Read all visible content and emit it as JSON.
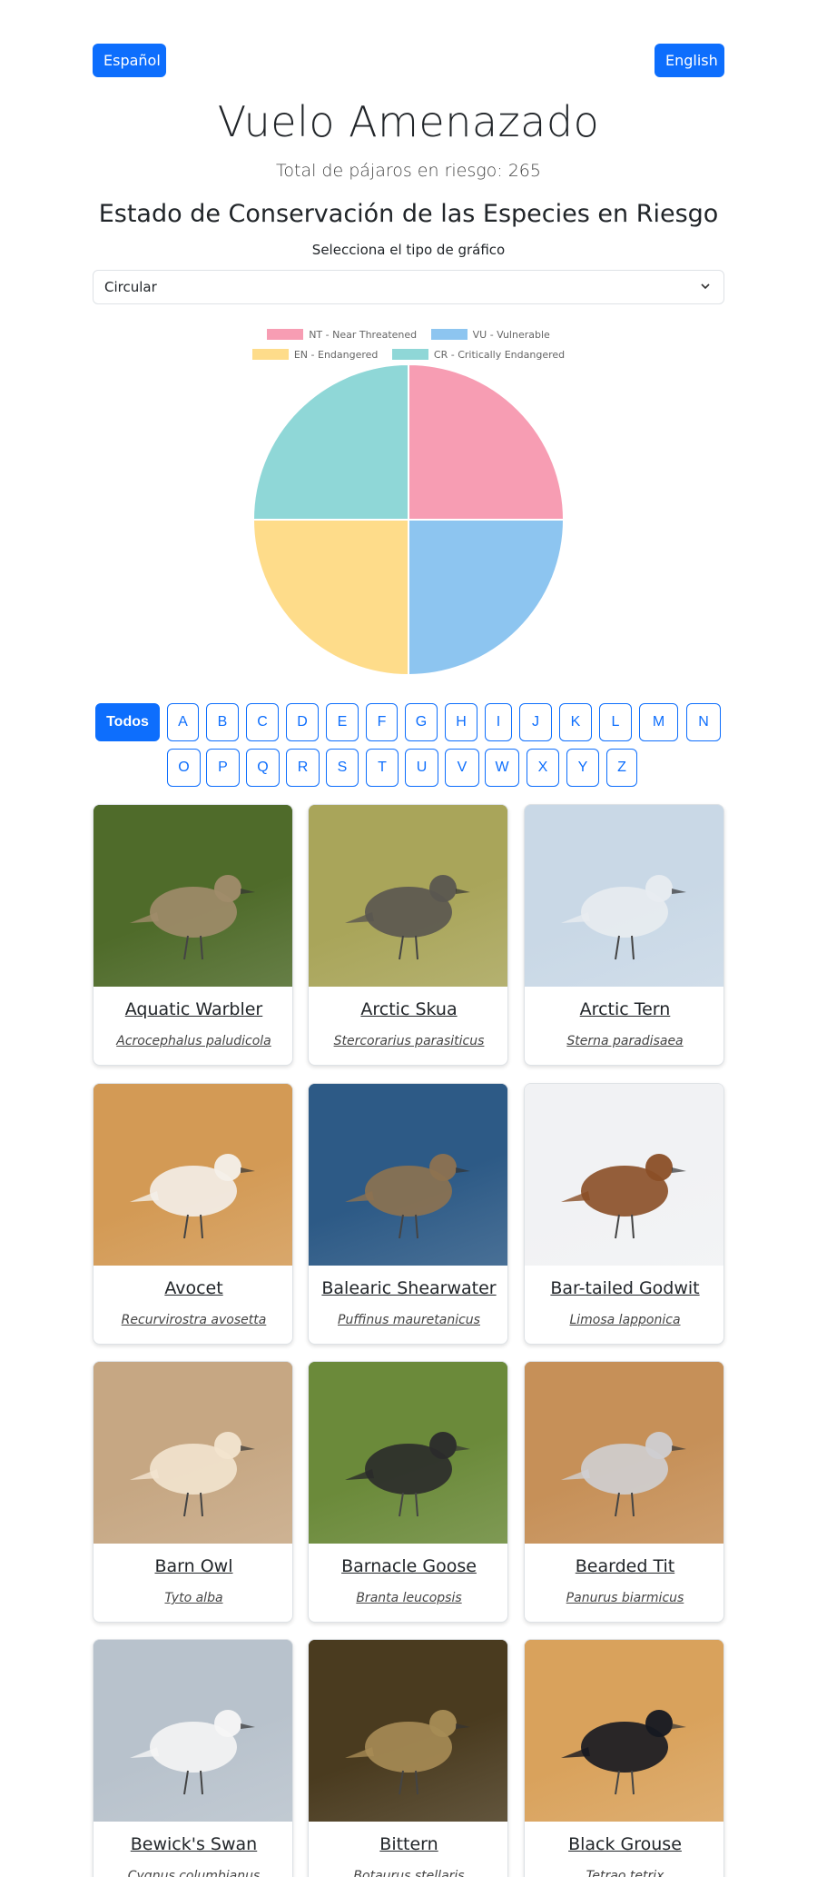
{
  "header": {
    "lang_es": "Español",
    "lang_en": "English",
    "title": "Vuelo Amenazado",
    "total": "Total de pájaros en riesgo: 265"
  },
  "chart_section": {
    "title": "Estado de Conservación de las Especies en Riesgo",
    "select_label": "Selecciona el tipo de gráfico",
    "select_value": "Circular"
  },
  "chart_data": {
    "type": "pie",
    "categories": [
      "NT - Near Threatened",
      "VU - Vulnerable",
      "EN - Endangered",
      "CR - Critically Endangered"
    ],
    "values": [
      25,
      25,
      25,
      25
    ],
    "colors": [
      "#f79db3",
      "#8dc5f0",
      "#fedc8a",
      "#8fd7d7"
    ],
    "legend_position": "top"
  },
  "filters": {
    "all_label": "Todos",
    "letters": [
      "A",
      "B",
      "C",
      "D",
      "E",
      "F",
      "G",
      "H",
      "I",
      "J",
      "K",
      "L",
      "M",
      "N",
      "O",
      "P",
      "Q",
      "R",
      "S",
      "T",
      "U",
      "V",
      "W",
      "X",
      "Y",
      "Z"
    ]
  },
  "birds": [
    {
      "name": "Aquatic Warbler",
      "scientific": "Acrocephalus paludicola",
      "icon": "warbler-photo",
      "bg": "#4f6b2a",
      "fg": "#a08c6a"
    },
    {
      "name": "Arctic Skua",
      "scientific": "Stercorarius parasiticus",
      "icon": "skua-photo",
      "bg": "#a9a55a",
      "fg": "#5a5650"
    },
    {
      "name": "Arctic Tern",
      "scientific": "Sterna paradisaea",
      "icon": "tern-photo",
      "bg": "#c9d8e6",
      "fg": "#e8ecf0"
    },
    {
      "name": "Avocet",
      "scientific": "Recurvirostra avosetta",
      "icon": "avocet-photo",
      "bg": "#d39a55",
      "fg": "#f4f0ea"
    },
    {
      "name": "Balearic Shearwater",
      "scientific": "Puffinus mauretanicus",
      "icon": "shearwater-photo",
      "bg": "#2d5a86",
      "fg": "#8d7250"
    },
    {
      "name": "Bar-tailed Godwit",
      "scientific": "Limosa lapponica",
      "icon": "godwit-photo",
      "bg": "#f1f2f4",
      "fg": "#8a4e26"
    },
    {
      "name": "Barn Owl",
      "scientific": "Tyto alba",
      "icon": "owl-photo",
      "bg": "#c6a783",
      "fg": "#f2e4cf"
    },
    {
      "name": "Barnacle Goose",
      "scientific": "Branta leucopsis",
      "icon": "goose-photo",
      "bg": "#6b8a3a",
      "fg": "#2b2b2b"
    },
    {
      "name": "Bearded Tit",
      "scientific": "Panurus biarmicus",
      "icon": "tit-photo",
      "bg": "#c69058",
      "fg": "#cfcfd2"
    },
    {
      "name": "Bewick's Swan",
      "scientific": "Cygnus columbianus",
      "icon": "swan-photo",
      "bg": "#b8c2cc",
      "fg": "#f5f5f5"
    },
    {
      "name": "Bittern",
      "scientific": "Botaurus stellaris",
      "icon": "bittern-photo",
      "bg": "#4a3b1f",
      "fg": "#a78c55"
    },
    {
      "name": "Black Grouse",
      "scientific": "Tetrao tetrix",
      "icon": "grouse-photo",
      "bg": "#d9a25c",
      "fg": "#151821"
    }
  ]
}
